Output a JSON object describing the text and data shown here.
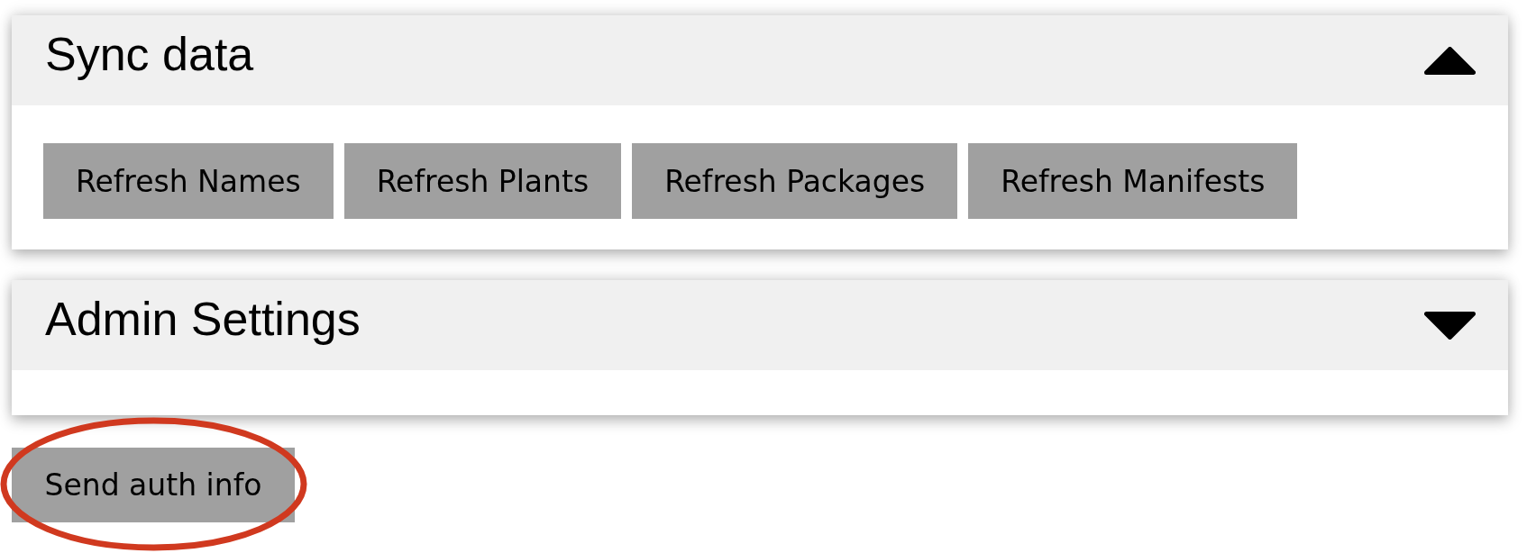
{
  "panels": [
    {
      "title": "Sync data",
      "expanded": true,
      "buttons": [
        "Refresh Names",
        "Refresh Plants",
        "Refresh Packages",
        "Refresh Manifests"
      ]
    },
    {
      "title": "Admin Settings",
      "expanded": false
    }
  ],
  "send_button": {
    "label": "Send auth info",
    "highlighted": true
  }
}
